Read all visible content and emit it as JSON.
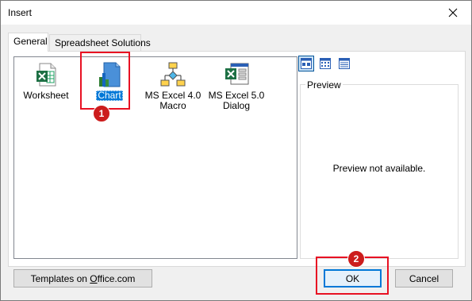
{
  "window": {
    "title": "Insert",
    "close_icon": "close-icon"
  },
  "tabs": [
    {
      "label": "General",
      "active": true
    },
    {
      "label": "Spreadsheet Solutions",
      "active": false
    }
  ],
  "templates": [
    {
      "label": "Worksheet",
      "icon": "excel-worksheet-icon",
      "selected": false
    },
    {
      "label": "Chart",
      "icon": "chart-icon",
      "selected": true
    },
    {
      "label_lines": [
        "MS Excel 4.0",
        "Macro"
      ],
      "icon": "macro-flowchart-icon",
      "selected": false
    },
    {
      "label_lines": [
        "MS Excel 5.0",
        "Dialog"
      ],
      "icon": "excel-dialog-icon",
      "selected": false
    }
  ],
  "view_buttons": [
    {
      "name": "large-icons-view",
      "pressed": true
    },
    {
      "name": "list-view",
      "pressed": false
    },
    {
      "name": "details-view",
      "pressed": false
    }
  ],
  "preview": {
    "legend": "Preview",
    "message": "Preview not available."
  },
  "buttons": {
    "templates_prefix": "Templates on ",
    "templates_underlined": "O",
    "templates_suffix": "ffice.com",
    "ok": "OK",
    "cancel": "Cancel"
  },
  "annotations": {
    "step1": "1",
    "step2": "2",
    "color": "#e81123"
  },
  "colors": {
    "selection": "#0078d7",
    "dialog_bg": "#f0f0f0"
  }
}
